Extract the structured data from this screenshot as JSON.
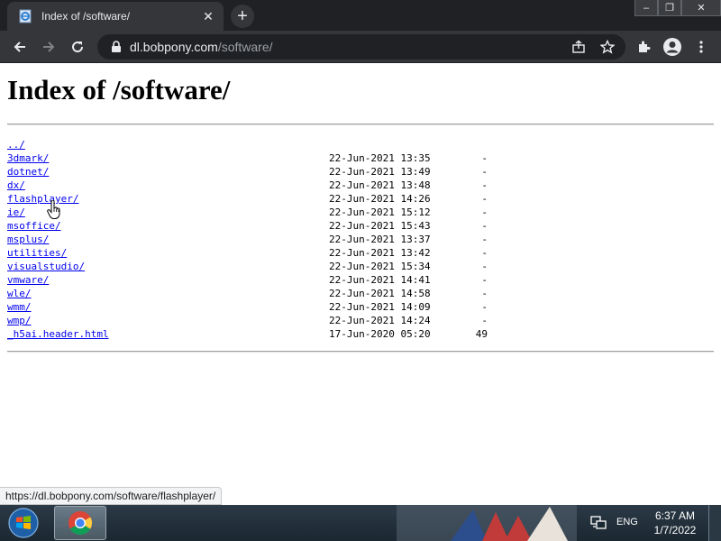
{
  "browser": {
    "tab": {
      "title": "Index of /software/",
      "favicon": "ie-page-icon"
    },
    "new_tab_symbol": "+",
    "window_controls": {
      "minimize": "–",
      "maximize": "❐",
      "close": "✕"
    },
    "address": {
      "host": "dl.bobpony.com",
      "path": "/software/"
    },
    "status_url": "https://dl.bobpony.com/software/flashplayer/"
  },
  "page": {
    "title": "Index of /software/",
    "entries": [
      {
        "name": "../",
        "date": "",
        "size": ""
      },
      {
        "name": "3dmark/",
        "date": "22-Jun-2021 13:35",
        "size": "-"
      },
      {
        "name": "dotnet/",
        "date": "22-Jun-2021 13:49",
        "size": "-"
      },
      {
        "name": "dx/",
        "date": "22-Jun-2021 13:48",
        "size": "-"
      },
      {
        "name": "flashplayer/",
        "date": "22-Jun-2021 14:26",
        "size": "-"
      },
      {
        "name": "ie/",
        "date": "22-Jun-2021 15:12",
        "size": "-"
      },
      {
        "name": "msoffice/",
        "date": "22-Jun-2021 15:43",
        "size": "-"
      },
      {
        "name": "msplus/",
        "date": "22-Jun-2021 13:37",
        "size": "-"
      },
      {
        "name": "utilities/",
        "date": "22-Jun-2021 13:42",
        "size": "-"
      },
      {
        "name": "visualstudio/",
        "date": "22-Jun-2021 15:34",
        "size": "-"
      },
      {
        "name": "vmware/",
        "date": "22-Jun-2021 14:41",
        "size": "-"
      },
      {
        "name": "wle/",
        "date": "22-Jun-2021 14:58",
        "size": "-"
      },
      {
        "name": "wmm/",
        "date": "22-Jun-2021 14:09",
        "size": "-"
      },
      {
        "name": "wmp/",
        "date": "22-Jun-2021 14:24",
        "size": "-"
      },
      {
        "name": "_h5ai.header.html",
        "date": "17-Jun-2020 05:20",
        "size": "49"
      }
    ]
  },
  "taskbar": {
    "language": "ENG",
    "time": "6:37 AM",
    "date": "1/7/2022"
  },
  "colors": {
    "chrome_dark": "#202124",
    "toolbar": "#35363a",
    "link": "#0000ee"
  }
}
